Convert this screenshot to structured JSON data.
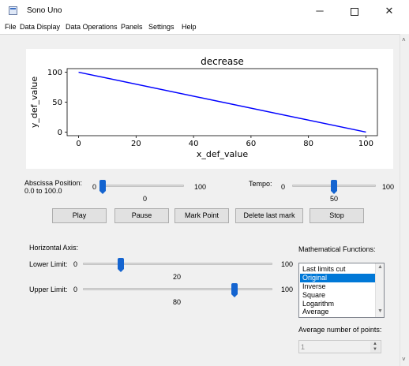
{
  "window": {
    "title": "Sono Uno",
    "minimize_glyph": "─",
    "close_glyph": "✕"
  },
  "menu": [
    "File",
    "Data Display",
    "Data Operations",
    "Panels",
    "Settings",
    "Help"
  ],
  "chart_data": {
    "type": "line",
    "title": "decrease",
    "xlabel": "x_def_value",
    "ylabel": "y_def_value",
    "x": [
      0,
      100
    ],
    "y": [
      100,
      0
    ],
    "xlim": [
      -4,
      104
    ],
    "ylim": [
      -6,
      106
    ],
    "xticks": [
      0,
      20,
      40,
      60,
      80,
      100
    ],
    "yticks": [
      0,
      50,
      100
    ],
    "line_color": "#0000ff",
    "grid": false
  },
  "abscissa": {
    "label": "Abscissa Position:",
    "range_text": "0.0 to 100.0",
    "min_label": "0",
    "max_label": "100",
    "value_label": "0",
    "value_fraction": 0
  },
  "tempo": {
    "label": "Tempo:",
    "min_label": "0",
    "max_label": "100",
    "value_label": "50",
    "value_fraction": 0.5
  },
  "buttons": {
    "play": "Play",
    "pause": "Pause",
    "mark_point": "Mark Point",
    "delete_last_mark": "Delete last mark",
    "stop": "Stop"
  },
  "horizontal_axis": {
    "title": "Horizontal Axis:",
    "lower": {
      "label": "Lower Limit:",
      "min_label": "0",
      "max_label": "100",
      "value_label": "20",
      "value_fraction": 0.2
    },
    "upper": {
      "label": "Upper Limit:",
      "min_label": "0",
      "max_label": "100",
      "value_label": "80",
      "value_fraction": 0.8
    }
  },
  "math_functions": {
    "title": "Mathematical Functions:",
    "items": [
      "Last limits cut",
      "Original",
      "Inverse",
      "Square",
      "Logarithm",
      "Average"
    ],
    "selected": "Original"
  },
  "average_points": {
    "label": "Average number of points:",
    "value": "1"
  },
  "colors": {
    "accent": "#0078d7",
    "slider_handle": "#1464d0"
  }
}
